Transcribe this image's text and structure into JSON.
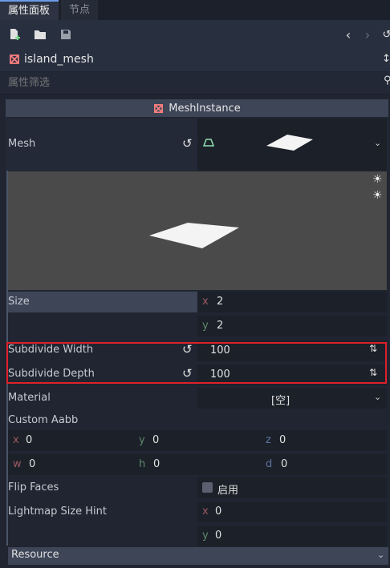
{
  "tabs": {
    "inspector": "属性面板",
    "node": "节点"
  },
  "object": {
    "name": "island_mesh"
  },
  "filter": {
    "placeholder": "属性筛选"
  },
  "section": {
    "title": "MeshInstance"
  },
  "mesh": {
    "label": "Mesh"
  },
  "props": {
    "size": {
      "label": "Size",
      "x_axis": "x",
      "x": "2",
      "y_axis": "y",
      "y": "2"
    },
    "subdivide_width": {
      "label": "Subdivide Width",
      "value": "100"
    },
    "subdivide_depth": {
      "label": "Subdivide Depth",
      "value": "100"
    },
    "material": {
      "label": "Material",
      "value": "[空]"
    },
    "custom_aabb": {
      "label": "Custom Aabb",
      "x_axis": "x",
      "x": "0",
      "y_axis": "y",
      "y": "0",
      "z_axis": "z",
      "z": "0",
      "w_axis": "w",
      "w": "0",
      "h_axis": "h",
      "h": "0",
      "d_axis": "d",
      "d": "0"
    },
    "flip_faces": {
      "label": "Flip Faces",
      "value": "启用",
      "checked": false
    },
    "lightmap": {
      "label": "Lightmap Size Hint",
      "x_axis": "x",
      "x": "0",
      "y_axis": "y",
      "y": "0"
    },
    "resource": {
      "label": "Resource"
    }
  },
  "colors": {
    "highlight": "#e0202a",
    "accent": "#699ce8",
    "preview_bg": "#4a4a4a"
  }
}
